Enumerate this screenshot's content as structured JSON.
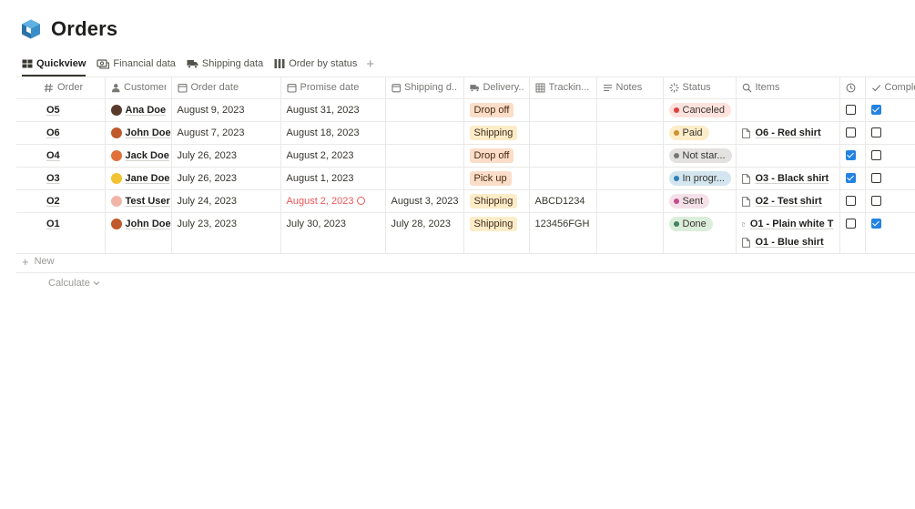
{
  "page": {
    "title": "Orders"
  },
  "views": [
    {
      "label": "Quickview",
      "icon": "grid-icon",
      "active": true
    },
    {
      "label": "Financial data",
      "icon": "cash-icon"
    },
    {
      "label": "Shipping data",
      "icon": "truck-icon"
    },
    {
      "label": "Order by status",
      "icon": "board-icon"
    }
  ],
  "add_view_label": "+",
  "columns": [
    {
      "label": "Order",
      "icon": "hash-icon"
    },
    {
      "label": "Customer",
      "icon": "person-icon"
    },
    {
      "label": "Order date",
      "icon": "calendar-icon"
    },
    {
      "label": "Promise date",
      "icon": "calendar-icon"
    },
    {
      "label": "Shipping d...",
      "icon": "calendar-icon"
    },
    {
      "label": "Delivery...",
      "icon": "truck-icon"
    },
    {
      "label": "Trackin...",
      "icon": "table-icon"
    },
    {
      "label": "Notes",
      "icon": "text-icon"
    },
    {
      "label": "Status",
      "icon": "status-icon"
    },
    {
      "label": "Items",
      "icon": "search-icon"
    },
    {
      "label": "",
      "icon": "clock-icon"
    },
    {
      "label": "Comple",
      "icon": "check-icon"
    }
  ],
  "rows": [
    {
      "order": "O5",
      "customer": "Ana Doe",
      "avatar_color": "#5a3a2a",
      "order_date": "August 9, 2023",
      "promise_date": "August 31, 2023",
      "promise_late": false,
      "shipping_date": "",
      "delivery": "Drop off",
      "delivery_color": "orange",
      "tracking": "",
      "notes": "",
      "status": "Canceled",
      "status_bg": "#ffe2dd",
      "status_dot": "#e03e3e",
      "items": [],
      "timer": false,
      "complete": true
    },
    {
      "order": "O6",
      "customer": "John Doe",
      "avatar_color": "#c0592b",
      "order_date": "August 7, 2023",
      "promise_date": "August 18, 2023",
      "promise_late": false,
      "shipping_date": "",
      "delivery": "Shipping",
      "delivery_color": "yellow",
      "tracking": "",
      "notes": "",
      "status": "Paid",
      "status_bg": "#fdecc8",
      "status_dot": "#cb912f",
      "items": [
        "O6 - Red shirt"
      ],
      "timer": false,
      "complete": false
    },
    {
      "order": "O4",
      "customer": "Jack Doe",
      "avatar_color": "#e0703a",
      "order_date": "July 26, 2023",
      "promise_date": "August 2, 2023",
      "promise_late": false,
      "shipping_date": "",
      "delivery": "Drop off",
      "delivery_color": "orange",
      "tracking": "",
      "notes": "",
      "status": "Not star...",
      "status_bg": "#e3e2e0",
      "status_dot": "#787774",
      "items": [],
      "timer": true,
      "complete": false
    },
    {
      "order": "O3",
      "customer": "Jane Doe",
      "avatar_color": "#f2c230",
      "order_date": "July 26, 2023",
      "promise_date": "August 1, 2023",
      "promise_late": false,
      "shipping_date": "",
      "delivery": "Pick up",
      "delivery_color": "orange",
      "tracking": "",
      "notes": "",
      "status": "In progr...",
      "status_bg": "#d3e5ef",
      "status_dot": "#2f7fb5",
      "items": [
        "O3 - Black shirt"
      ],
      "timer": true,
      "complete": false
    },
    {
      "order": "O2",
      "customer": "Test User",
      "avatar_color": "#f1b5a8",
      "order_date": "July 24, 2023",
      "promise_date": "August 2, 2023",
      "promise_late": true,
      "shipping_date": "August 3, 2023",
      "delivery": "Shipping",
      "delivery_color": "yellow",
      "tracking": "ABCD1234",
      "notes": "",
      "status": "Sent",
      "status_bg": "#f5e0e9",
      "status_dot": "#c14c8a",
      "items": [
        "O2 - Test shirt"
      ],
      "timer": false,
      "complete": false
    },
    {
      "order": "O1",
      "customer": "John Doe",
      "avatar_color": "#c0592b",
      "order_date": "July 23, 2023",
      "promise_date": "July 30, 2023",
      "promise_late": false,
      "shipping_date": "July 28, 2023",
      "delivery": "Shipping",
      "delivery_color": "yellow",
      "tracking": "123456FGH",
      "notes": "",
      "status": "Done",
      "status_bg": "#dbeddb",
      "status_dot": "#448361",
      "items": [
        "O1 - Plain white T",
        "O1 - Blue shirt"
      ],
      "timer": false,
      "complete": true
    }
  ],
  "new_label": "New",
  "calculate_label": "Calculate",
  "colors": {
    "accent": "#2383e2",
    "late": "#eb5757",
    "border": "#e9e9e7"
  }
}
